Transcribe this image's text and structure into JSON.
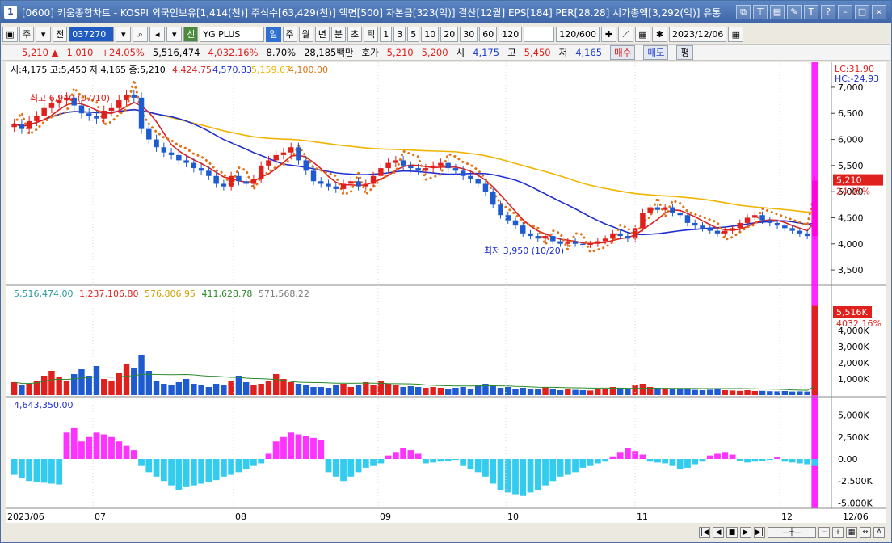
{
  "window": {
    "number": "1",
    "title": "[0600] 키움종합차트 - KOSPI 외국인보유[1,414(천)] 주식수[63,429(천)] 액면[500] 자본금[323(억)] 결산[12월] EPS[184] PER[28.28] 시가총액[3,292(억)] 유통"
  },
  "toolbar": {
    "period_week": "주",
    "prev": "전",
    "code": "037270",
    "stock_name": "YG PLUS",
    "stock_tag": "신",
    "tabs": [
      "일",
      "주",
      "월",
      "년",
      "분",
      "초",
      "틱"
    ],
    "minutes": [
      "1",
      "3",
      "5",
      "10",
      "20",
      "30",
      "60",
      "120"
    ],
    "count": "120/600",
    "date": "2023/12/06"
  },
  "info": {
    "price": "5,210",
    "change": "1,010",
    "change_pct": "+24.05%",
    "volume": "5,516,474",
    "volume_pct": "4,032.16%",
    "turnover": "8.70%",
    "amount": "28,185백만",
    "quote_label": "호가",
    "ask": "5,210",
    "bid": "5,200",
    "open_label": "시",
    "open": "4,175",
    "high_label": "고",
    "high": "5,450",
    "low_label": "저",
    "low": "4,165",
    "buy": "매수",
    "sell": "매도",
    "avg": "평"
  },
  "chart_data": {
    "type": "candlestick",
    "ohlc_label": "시:4,175 고:5,450 저:4,165 종:5,210",
    "ma_values": [
      "4,424.75",
      "4,570.83",
      "5,159.67",
      "4,100.00"
    ],
    "ma_colors": [
      "#e0201c",
      "#1f2fd0",
      "#f0b400",
      "#e07010"
    ],
    "y_ticks": [
      3500,
      4000,
      4500,
      5000,
      5500,
      6000,
      6500,
      7000
    ],
    "ylim": [
      3300,
      7200
    ],
    "lc": "LC:31.90",
    "hc": "HC:-24.93",
    "last_price": "5,210",
    "last_pct": "24.05%",
    "high_annotation": "최고 6,940 (07/10)",
    "low_annotation": "최저 3,950 (10/20)",
    "x_labels": [
      "2023/06",
      "07",
      "08",
      "09",
      "10",
      "11",
      "12",
      "12/06"
    ],
    "close": [
      6300,
      6200,
      6350,
      6450,
      6600,
      6700,
      6750,
      6800,
      6650,
      6500,
      6450,
      6400,
      6550,
      6600,
      6750,
      6850,
      6800,
      6200,
      6000,
      5850,
      5750,
      5700,
      5600,
      5550,
      5450,
      5400,
      5300,
      5150,
      5100,
      5300,
      5200,
      5150,
      5250,
      5500,
      5600,
      5700,
      5750,
      5850,
      5600,
      5400,
      5200,
      5150,
      5100,
      5050,
      5150,
      5200,
      5100,
      5150,
      5300,
      5450,
      5550,
      5600,
      5500,
      5450,
      5400,
      5450,
      5500,
      5550,
      5450,
      5400,
      5300,
      5250,
      5150,
      5000,
      4750,
      4550,
      4450,
      4350,
      4200,
      4150,
      4100,
      4150,
      4050,
      4000,
      4050,
      4000,
      3980,
      4000,
      4050,
      4100,
      4200,
      4150,
      4100,
      4300,
      4600,
      4700,
      4650,
      4700,
      4600,
      4550,
      4400,
      4350,
      4300,
      4250,
      4200,
      4250,
      4300,
      4400,
      4500,
      4550,
      4450,
      4400,
      4350,
      4300,
      4250,
      4200,
      4150,
      5210
    ],
    "volume_label_values": [
      "5,516,474.00",
      "1,237,106.80",
      "576,806.95",
      "411,628.78",
      "571,568.22"
    ],
    "volume_ticks": [
      "1,000K",
      "2,000K",
      "3,000K",
      "4,000K"
    ],
    "volume_last": "5,516K",
    "volume_last_pct": "4032.16%",
    "volume": [
      800,
      650,
      700,
      900,
      1200,
      1500,
      1100,
      900,
      1300,
      1600,
      1200,
      1800,
      1000,
      900,
      1400,
      1900,
      1700,
      2500,
      1500,
      900,
      700,
      600,
      800,
      1000,
      700,
      600,
      500,
      700,
      650,
      900,
      1200,
      800,
      600,
      700,
      900,
      1300,
      1000,
      800,
      700,
      600,
      500,
      500,
      450,
      600,
      700,
      500,
      650,
      800,
      600,
      900,
      700,
      600,
      500,
      550,
      500,
      450,
      500,
      450,
      400,
      450,
      500,
      400,
      600,
      700,
      650,
      450,
      500,
      400,
      450,
      380,
      350,
      500,
      400,
      300,
      350,
      320,
      300,
      280,
      350,
      400,
      500,
      450,
      350,
      600,
      700,
      500,
      450,
      400,
      380,
      400,
      350,
      320,
      300,
      330,
      350,
      300,
      280,
      260,
      300,
      250,
      260,
      240,
      230,
      250,
      220,
      230,
      220,
      5516
    ],
    "osc_label": "4,643,350.00",
    "osc_ticks": [
      "5,000K",
      "2,500K",
      "0.00",
      "-2,500K",
      "-5,000K"
    ],
    "oscillator": [
      -1800,
      -2200,
      -2500,
      -2600,
      -2700,
      -2800,
      -2900,
      3000,
      3500,
      2000,
      2500,
      3000,
      2800,
      2500,
      2000,
      1500,
      1000,
      -800,
      -1500,
      -2000,
      -2500,
      -3000,
      -3500,
      -3200,
      -3000,
      -2800,
      -2600,
      -2400,
      -2000,
      -1800,
      -1500,
      -1200,
      -800,
      -500,
      600,
      2000,
      2500,
      3000,
      2800,
      2600,
      2400,
      2200,
      -1500,
      -2000,
      -2500,
      -2000,
      -1500,
      -1000,
      -800,
      -500,
      400,
      800,
      1200,
      1000,
      600,
      -500,
      -400,
      -300,
      -200,
      -100,
      -800,
      -1200,
      -1500,
      -2000,
      -2800,
      -3500,
      -3800,
      -4000,
      -4200,
      -3800,
      -3500,
      -3000,
      -2500,
      -2000,
      -1800,
      -1500,
      -1000,
      -800,
      -500,
      -300,
      300,
      800,
      1200,
      900,
      500,
      -300,
      -400,
      -500,
      -800,
      -1200,
      -1000,
      -600,
      -300,
      400,
      600,
      800,
      500,
      -200,
      -400,
      -300,
      -200,
      -100,
      200,
      -300,
      -400,
      -500,
      -600,
      -800
    ]
  }
}
